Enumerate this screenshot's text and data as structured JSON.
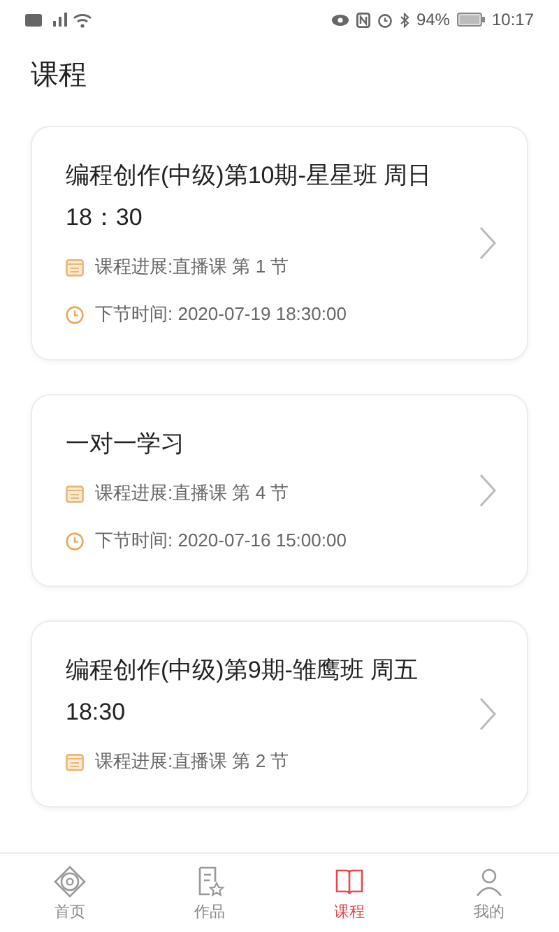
{
  "status_bar": {
    "battery_text": "94%",
    "time": "10:17"
  },
  "page_title": "课程",
  "courses": [
    {
      "title": "编程创作(中级)第10期-星星班 周日 18：30",
      "progress": "课程进展:直播课 第 1 节",
      "next_time": "下节时间: 2020-07-19 18:30:00"
    },
    {
      "title": "一对一学习",
      "progress": "课程进展:直播课 第 4 节",
      "next_time": "下节时间: 2020-07-16 15:00:00"
    },
    {
      "title": "编程创作(中级)第9期-雏鹰班 周五 18:30",
      "progress": "课程进展:直播课 第 2 节"
    }
  ],
  "tabs": [
    {
      "label": "首页",
      "kind": "home",
      "selected": false
    },
    {
      "label": "作品",
      "kind": "works",
      "selected": false
    },
    {
      "label": "课程",
      "kind": "course",
      "selected": true
    },
    {
      "label": "我的",
      "kind": "me",
      "selected": false
    }
  ]
}
